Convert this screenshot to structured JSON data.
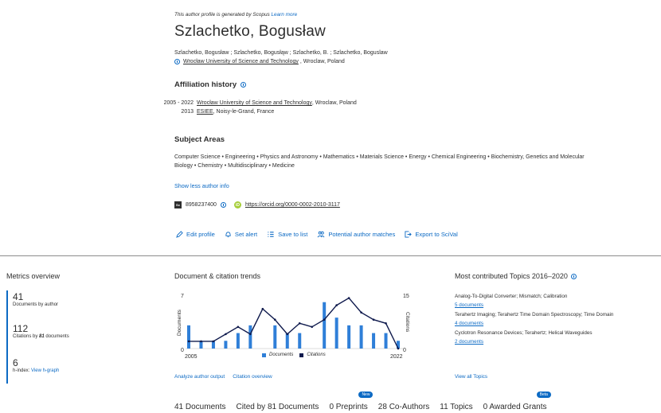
{
  "profile": {
    "note_text": "This author profile is generated by Scopus",
    "note_link": "Learn more",
    "name": "Szlachetko, Bogusław",
    "name_variants": "Szlachetko, Bogusław ; Szlachetko, Bogusłąw ; Szlachetko, B. ; Szlachetko, Boguslaw",
    "current_affiliation": "Wrocław University of Science and Technology",
    "current_location": ", Wroclaw, Poland"
  },
  "affiliation_history": {
    "title": "Affiliation history",
    "rows": [
      {
        "years": "2005 - 2022",
        "org": "Wrocław University of Science and Technology",
        "loc": ", Wroclaw, Poland"
      },
      {
        "years": "2013",
        "org": "ESIEE",
        "loc": ", Noisy-le-Grand, France"
      }
    ]
  },
  "subject_areas": {
    "title": "Subject Areas",
    "text": "Computer Science • Engineering • Physics and Astronomy • Mathematics • Materials Science • Energy • Chemical Engineering • Biochemistry, Genetics and Molecular Biology • Chemistry • Multidisciplinary • Medicine",
    "show_less": "Show less author info"
  },
  "identifiers": {
    "scopus_icon": "Sc",
    "scopus_id": "8958237400",
    "orcid_icon": "iD",
    "orcid_url": "https://orcid.org/0000-0002-2010-3117"
  },
  "actions": [
    {
      "icon": "pencil-icon",
      "label": "Edit profile"
    },
    {
      "icon": "bell-icon",
      "label": "Set alert"
    },
    {
      "icon": "list-icon",
      "label": "Save to list"
    },
    {
      "icon": "people-icon",
      "label": "Potential author matches"
    },
    {
      "icon": "export-icon",
      "label": "Export to SciVal"
    }
  ],
  "metrics": {
    "title": "Metrics overview",
    "documents_value": "41",
    "documents_label": "Documents by author",
    "citations_value": "112",
    "citations_label_pre": "Citations by ",
    "citations_label_num": "81",
    "citations_label_post": " documents",
    "hindex_value": "6",
    "hindex_label": "h-index:",
    "hindex_link": "View h-graph"
  },
  "trends": {
    "title": "Document & citation trends",
    "analyze_link": "Analyze author output",
    "citation_link": "Citation overview"
  },
  "chart_data": {
    "type": "bar",
    "x_start_label": "2005",
    "x_end_label": "2022",
    "ylabel_left": "Documents",
    "ylabel_right": "Citations",
    "y_left_max_label": "7",
    "y_left_min_label": "0",
    "y_right_max_label": "15",
    "y_right_min_label": "0",
    "ylim_left": [
      0,
      7
    ],
    "ylim_right": [
      0,
      15
    ],
    "categories": [
      "2005",
      "2006",
      "2007",
      "2008",
      "2009",
      "2010",
      "2011",
      "2012",
      "2013",
      "2014",
      "2015",
      "2016",
      "2017",
      "2018",
      "2019",
      "2020",
      "2021",
      "2022"
    ],
    "series": [
      {
        "name": "Documents",
        "color": "#2f7fd8",
        "values": [
          3,
          1,
          1,
          1,
          2,
          3,
          0,
          3,
          2,
          2,
          0,
          6,
          4,
          3,
          3,
          2,
          2,
          1
        ]
      },
      {
        "name": "Citations",
        "color": "#0f1a4d",
        "values": [
          2,
          2,
          2,
          4,
          6,
          4,
          11,
          8,
          4,
          7,
          6,
          8,
          12,
          14,
          10,
          8,
          7,
          0
        ]
      }
    ]
  },
  "topics": {
    "title": "Most contributed Topics 2016–2020",
    "items": [
      {
        "title": "Analog-To-Digital Converter; Mismatch; Calibration",
        "count": "5 documents"
      },
      {
        "title": "Terahertz Imaging; Terahertz Time Domain Spectroscopy; Time Domain",
        "count": "4 documents"
      },
      {
        "title": "Cyclotron Resonance Devices; Terahertz; Helical Waveguides",
        "count": "2 documents"
      }
    ],
    "view_all": "View all Topics"
  },
  "tabs": [
    {
      "label": "41 Documents",
      "badge": ""
    },
    {
      "label": "Cited by 81 Documents",
      "badge": ""
    },
    {
      "label": "0 Preprints",
      "badge": "New"
    },
    {
      "label": "28 Co-Authors",
      "badge": ""
    },
    {
      "label": "11 Topics",
      "badge": ""
    },
    {
      "label": "0 Awarded Grants",
      "badge": "Beta"
    }
  ],
  "colors": {
    "link": "#0c6ac4",
    "documents_bar": "#2f7fd8",
    "citations_line": "#0f1a4d",
    "orcid": "#a6ce39"
  }
}
